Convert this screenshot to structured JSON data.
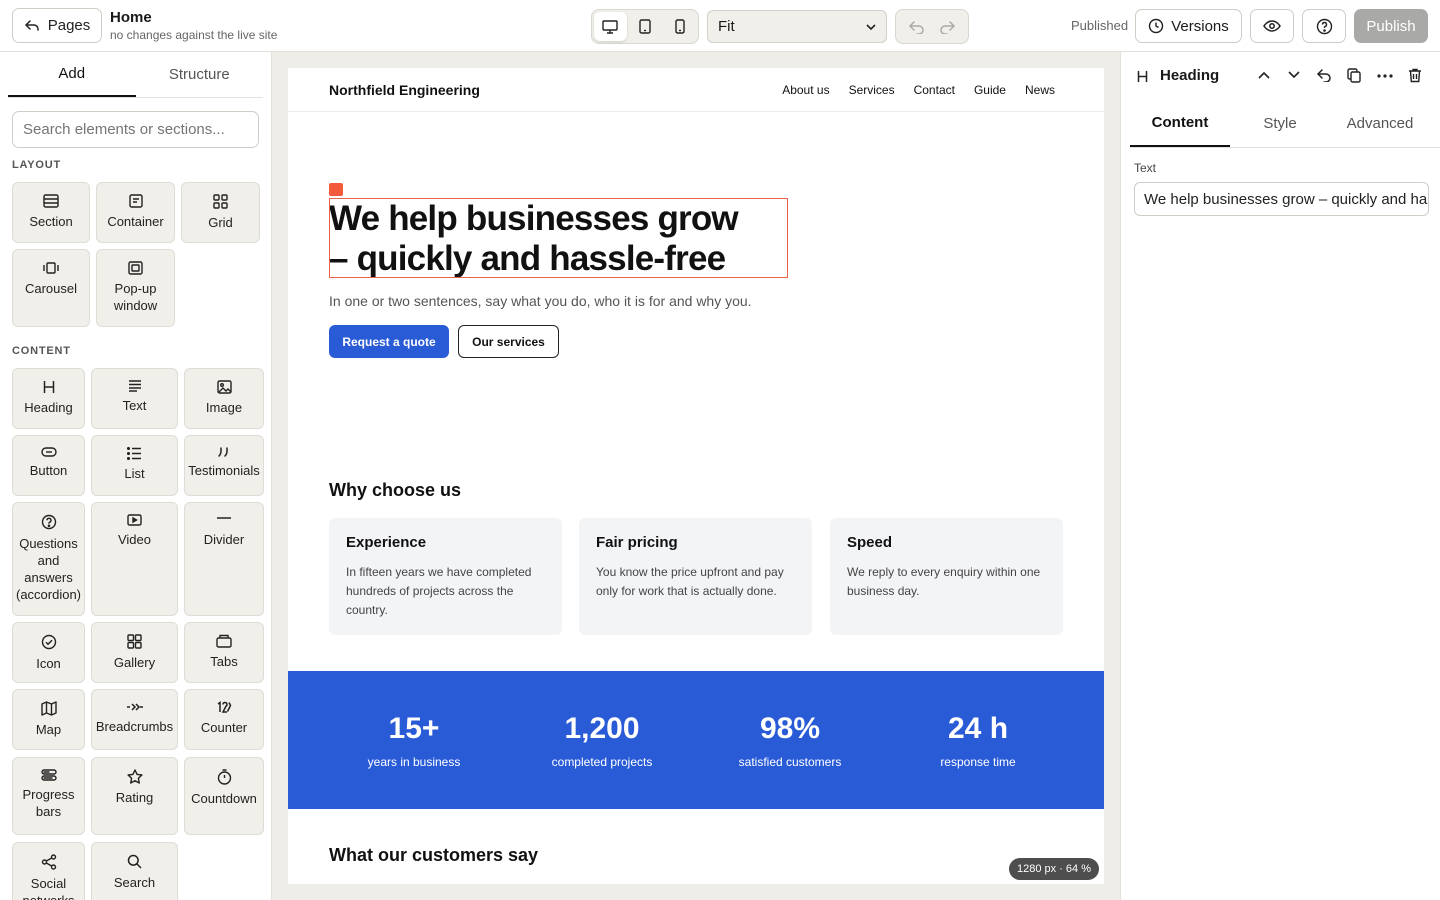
{
  "topbar": {
    "pages_label": "Pages",
    "page_title": "Home",
    "page_subtitle": "no changes against the live site",
    "zoom_value": "Fit",
    "status": "Published",
    "versions_label": "Versions",
    "publish_label": "Publish"
  },
  "left_panel": {
    "tabs": [
      "Add",
      "Structure"
    ],
    "search_placeholder": "Search elements or sections...",
    "layout_label": "LAYOUT",
    "content_label": "CONTENT",
    "layout_items": [
      {
        "label": "Section",
        "icon": "section-icon"
      },
      {
        "label": "Container",
        "icon": "container-icon"
      },
      {
        "label": "Grid",
        "icon": "grid-icon"
      },
      {
        "label": "Carousel",
        "icon": "carousel-icon"
      },
      {
        "label": "Pop-up window",
        "icon": "popup-icon"
      }
    ],
    "content_items": [
      {
        "label": "Heading",
        "icon": "heading-icon"
      },
      {
        "label": "Text",
        "icon": "text-icon"
      },
      {
        "label": "Image",
        "icon": "image-icon"
      },
      {
        "label": "Button",
        "icon": "button-icon"
      },
      {
        "label": "List",
        "icon": "list-icon"
      },
      {
        "label": "Testimonials",
        "icon": "quote-icon"
      },
      {
        "label": "Questions and answers (accordion)",
        "icon": "question-icon"
      },
      {
        "label": "Video",
        "icon": "video-icon"
      },
      {
        "label": "Divider",
        "icon": "divider-icon"
      },
      {
        "label": "Icon",
        "icon": "check-circle-icon"
      },
      {
        "label": "Gallery",
        "icon": "gallery-icon"
      },
      {
        "label": "Tabs",
        "icon": "tabs-icon"
      },
      {
        "label": "Map",
        "icon": "map-icon"
      },
      {
        "label": "Breadcrumbs",
        "icon": "breadcrumbs-icon"
      },
      {
        "label": "Counter",
        "icon": "counter-icon"
      },
      {
        "label": "Progress bars",
        "icon": "progress-icon"
      },
      {
        "label": "Rating",
        "icon": "star-icon"
      },
      {
        "label": "Countdown",
        "icon": "stopwatch-icon"
      },
      {
        "label": "Social networks",
        "icon": "share-icon"
      },
      {
        "label": "Search",
        "icon": "search-icon"
      }
    ]
  },
  "site": {
    "brand": "Northfield Engineering",
    "nav": [
      "About us",
      "Services",
      "Contact",
      "Guide",
      "News"
    ],
    "hero_line1": "We help businesses grow",
    "hero_line2": "– quickly and hassle-free",
    "hero_text": "In one or two sentences, say what you do, who it is for and why you.",
    "cta_primary": "Request a quote",
    "cta_secondary": "Our services",
    "why_heading": "Why choose us",
    "cards": [
      {
        "title": "Experience",
        "text": "In fifteen years we have completed hundreds of projects across the country."
      },
      {
        "title": "Fair pricing",
        "text": "You know the price upfront and pay only for work that is actually done."
      },
      {
        "title": "Speed",
        "text": "We reply to every enquiry within one business day."
      }
    ],
    "stats": [
      {
        "value": "15+",
        "label": "years in business"
      },
      {
        "value": "1,200",
        "label": "completed projects"
      },
      {
        "value": "98%",
        "label": "satisfied customers"
      },
      {
        "value": "24 h",
        "label": "response time"
      }
    ],
    "customers_heading": "What our customers say"
  },
  "zoom_badge": "1280 px · 64 %",
  "right_panel": {
    "element_title": "Heading",
    "tabs": [
      "Content",
      "Style",
      "Advanced"
    ],
    "text_label": "Text",
    "text_value": "We help businesses grow – quickly and hassle-free"
  },
  "colors": {
    "accent": "#2a5bd7",
    "selection": "#e8604a",
    "publish_disabled": "#a9a9a7"
  }
}
